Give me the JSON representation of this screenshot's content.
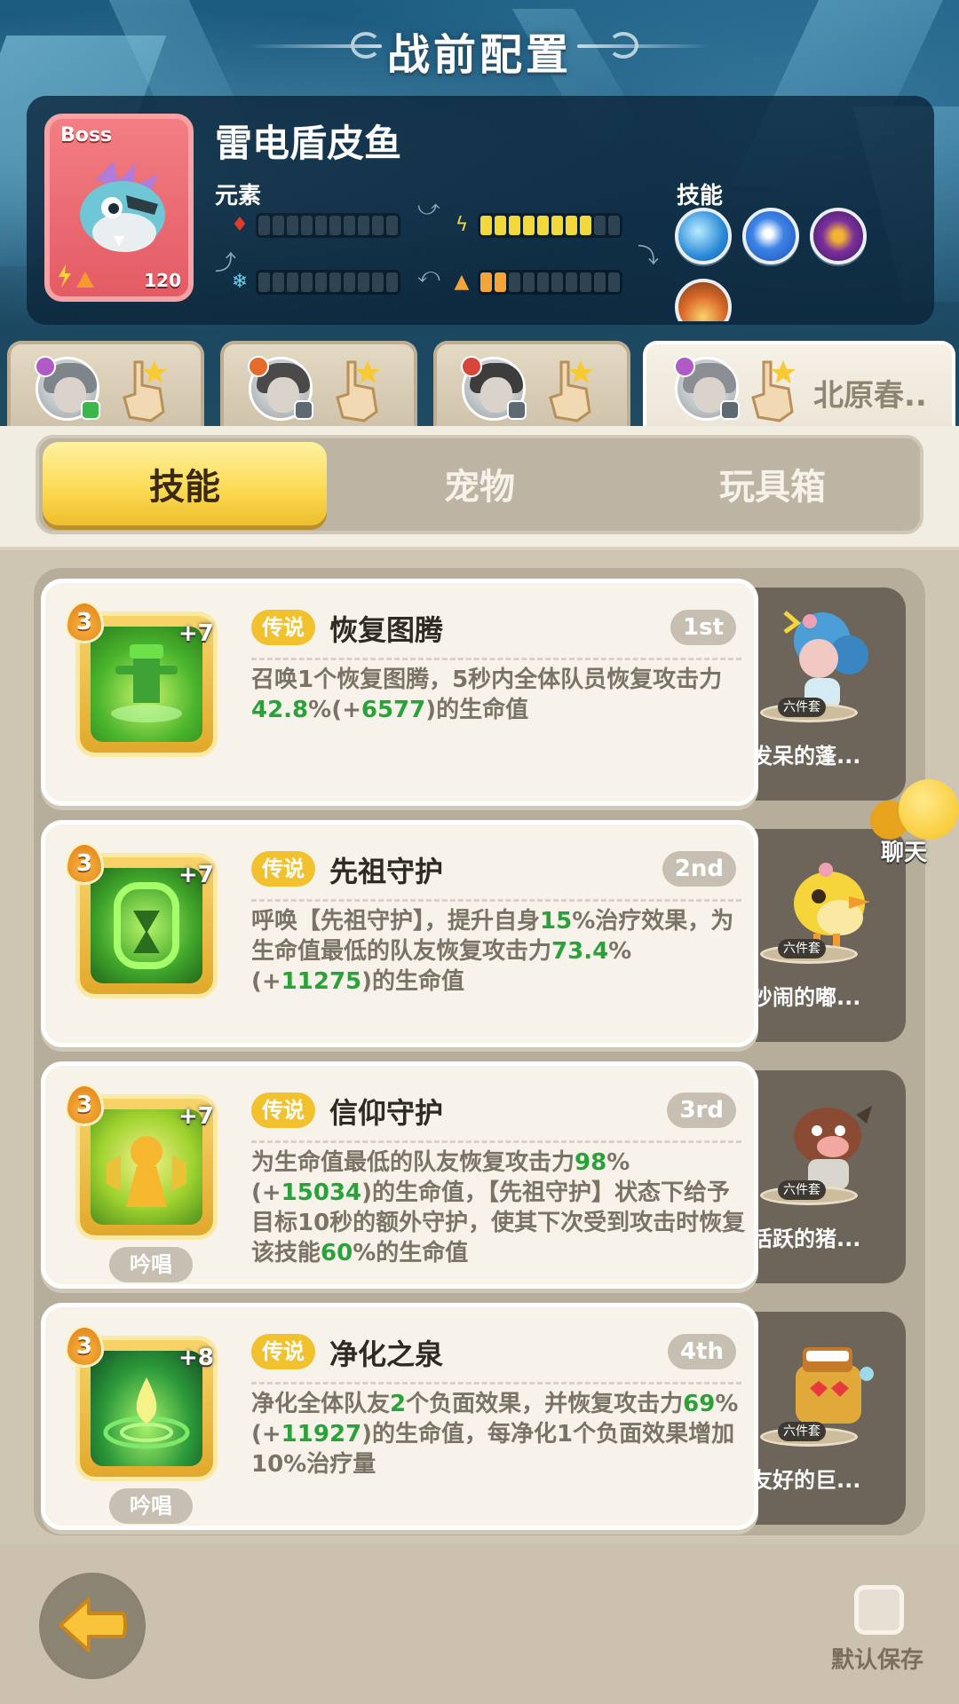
{
  "header": {
    "title": "战前配置"
  },
  "boss": {
    "tag": "Boss",
    "level": "120",
    "name": "雷电盾皮鱼",
    "element_label": "元素",
    "skill_label": "技能",
    "elements": [
      {
        "icon": "fire-icon",
        "filled": 0,
        "total": 10,
        "color": "#e23b2d"
      },
      {
        "icon": "lightning-icon",
        "filled": 8,
        "total": 10,
        "color": "#f2d83a"
      },
      {
        "icon": "ice-icon",
        "filled": 0,
        "total": 10,
        "color": "#6bd3f0"
      },
      {
        "icon": "earth-icon",
        "filled": 2,
        "total": 10,
        "color": "#f3a53a"
      }
    ]
  },
  "team": {
    "active_name": "北原春.."
  },
  "tabs": [
    "技能",
    "宠物",
    "玩具箱"
  ],
  "skills": [
    {
      "level": "3",
      "plus": "+7",
      "tag": "传说",
      "name": "恢复图腾",
      "rank": "1st",
      "desc_parts": [
        "召唤1个恢复图腾，5秒内全体队员恢复攻击力",
        "42.8",
        "%(+",
        "6577",
        ")的生命值"
      ],
      "chant": "",
      "pet_name": "发呆的蓬...",
      "pet_set": "六件套"
    },
    {
      "level": "3",
      "plus": "+7",
      "tag": "传说",
      "name": "先祖守护",
      "rank": "2nd",
      "desc_parts": [
        "呼唤【先祖守护】，提升自身",
        "15",
        "%治疗效果，为生命值最低的队友恢复攻击力",
        "73.4",
        "%(+",
        "11275",
        ")的生命值"
      ],
      "chant": "",
      "pet_name": "吵闹的嘟...",
      "pet_set": "六件套"
    },
    {
      "level": "3",
      "plus": "+7",
      "tag": "传说",
      "name": "信仰守护",
      "rank": "3rd",
      "desc_parts": [
        "为生命值最低的队友恢复攻击力",
        "98",
        "%(+",
        "15034",
        ")的生命值，【先祖守护】状态下给予目标10秒的额外守护，使其下次受到攻击时恢复该技能",
        "60",
        "%的生命值"
      ],
      "chant": "吟唱",
      "pet_name": "活跃的猪...",
      "pet_set": "六件套"
    },
    {
      "level": "3",
      "plus": "+8",
      "tag": "传说",
      "name": "净化之泉",
      "rank": "4th",
      "desc_parts": [
        "净化全体队友",
        "2",
        "个负面效果，并恢复攻击力",
        "69",
        "%(+",
        "11927",
        ")的生命值，每净化1个负面效果增加10%治疗量"
      ],
      "chant": "吟唱",
      "pet_name": "友好的巨...",
      "pet_set": "六件套"
    }
  ],
  "chat": {
    "label": "聊天"
  },
  "footer": {
    "save_label": "默认保存"
  },
  "colors": {
    "accent": "#fbd94f",
    "highlight_number": "#2aa23a",
    "legend_tag": "#f2c12e"
  }
}
